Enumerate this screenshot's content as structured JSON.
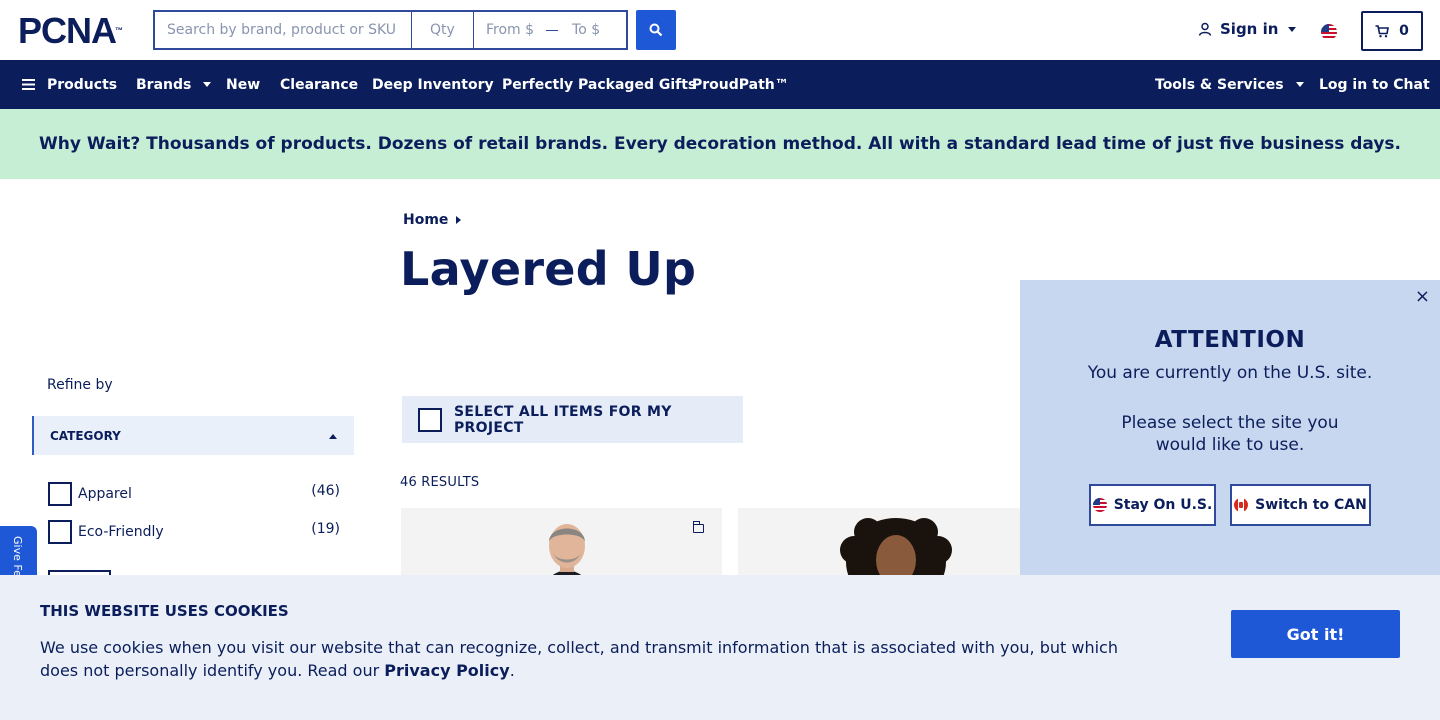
{
  "header": {
    "logo_text": "PCNA",
    "logo_mark": "™",
    "search_placeholder": "Search by brand, product or SKU",
    "qty_placeholder": "Qty",
    "from_placeholder": "From $",
    "to_placeholder": "To $",
    "sign_in_label": "Sign in",
    "cart_count": "0"
  },
  "nav": {
    "items": [
      "Products",
      "Brands",
      "New",
      "Clearance",
      "Deep Inventory",
      "Perfectly Packaged Gifts",
      "ProudPath™"
    ],
    "right_items": [
      "Tools & Services",
      "Log in to Chat"
    ]
  },
  "promo": {
    "text": "Why Wait? Thousands of products. Dozens of retail brands. Every decoration method. All with a standard lead time of just five business days."
  },
  "breadcrumb": {
    "home": "Home"
  },
  "page": {
    "title": "Layered Up"
  },
  "sidebar": {
    "refine_label": "Refine by",
    "category_label": "CATEGORY",
    "filters": [
      {
        "label": "Apparel",
        "count": "(46)"
      },
      {
        "label": "Eco-Friendly",
        "count": "(19)"
      }
    ],
    "feedback_label": "Give Feedback"
  },
  "listing": {
    "select_all_label": "SELECT ALL ITEMS FOR MY PROJECT",
    "results_label": "46 RESULTS"
  },
  "attention": {
    "title": "ATTENTION",
    "line1": "You are currently on the U.S. site.",
    "line2": "Please select the site you would like to use.",
    "stay_label": "Stay On U.S.",
    "switch_label": "Switch to CAN",
    "close_symbol": "×"
  },
  "cookies": {
    "title": "THIS WEBSITE USES COOKIES",
    "body": "We use cookies when you visit our website that can recognize, collect, and transmit information that is associated with you, but which does not personally identify you. Read our",
    "link": "Privacy Policy",
    "end": ".",
    "button": "Got it!"
  },
  "colors": {
    "navy": "#0b1e5b",
    "accent_blue": "#1f58d6",
    "promo_bg": "#c6eed5",
    "popup_bg": "#c7d7ef",
    "cookie_bg": "#ebf0f8"
  }
}
